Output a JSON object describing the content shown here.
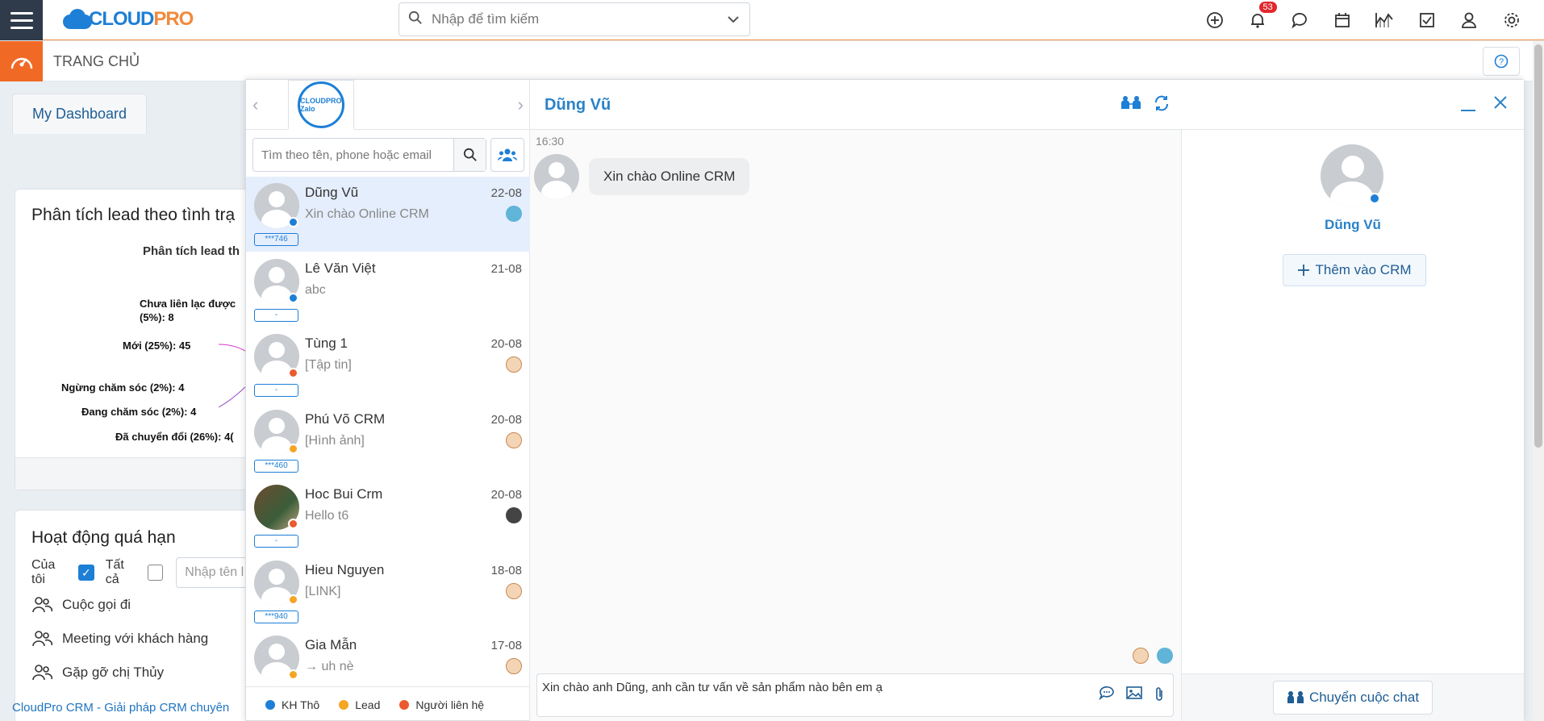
{
  "header": {
    "logo_text_a": "CLOUD",
    "logo_text_b": "PRO",
    "search_placeholder": "Nhập để tìm kiếm",
    "notification_count": "53",
    "icons": [
      "plus-circle-icon",
      "bell-icon",
      "chat-icon",
      "calendar-icon",
      "chart-icon",
      "checkbox-icon",
      "user-icon",
      "gear-icon"
    ]
  },
  "subbar": {
    "title": "TRANG CHỦ"
  },
  "dashboard": {
    "tab": "My Dashboard",
    "card1": {
      "title": "Phân tích lead theo tình trạ",
      "subtitle": "Phân tích lead th",
      "labels": [
        "Chưa liên lạc được",
        "(5%): 8",
        "Mới (25%): 45",
        "Ngừng chăm sóc (2%): 4",
        "Đang chăm sóc (2%): 4",
        "Đã chuyển đổi (26%): 4("
      ]
    },
    "card2": {
      "title": "Hoạt động quá hạn",
      "mine": "Của tôi",
      "all": "Tất cả",
      "input_placeholder": "Nhập tên l",
      "items": [
        "Cuộc gọi đi",
        "Meeting với khách hàng",
        "Gặp gỡ chị Thủy"
      ]
    },
    "footer": "CloudPro CRM - Giải pháp CRM chuyên"
  },
  "chat": {
    "search_placeholder": "Tìm theo tên, phone hoặc email",
    "account_logo": "CLOUDPRO Zalo",
    "conversations": [
      {
        "name": "Dũng Vũ",
        "date": "22-08",
        "message": "Xin chào Online CRM",
        "tag": "***746",
        "status": "kh",
        "mini": "blue",
        "active": true
      },
      {
        "name": "Lê Văn Việt",
        "date": "21-08",
        "message": "abc",
        "tag": "-",
        "status": "kh",
        "mini": "",
        "active": false
      },
      {
        "name": "Tùng 1",
        "date": "20-08",
        "message": "[Tập tin]",
        "tag": "-",
        "status": "nlh",
        "mini": "agent",
        "active": false
      },
      {
        "name": "Phú Võ CRM",
        "date": "20-08",
        "message": "[Hình ảnh]",
        "tag": "***460",
        "status": "lead",
        "mini": "agent",
        "active": false
      },
      {
        "name": "Hoc Bui Crm",
        "date": "20-08",
        "message": "Hello t6",
        "tag": "-",
        "status": "nlh",
        "mini": "dark",
        "active": false,
        "photo": true
      },
      {
        "name": "Hieu Nguyen",
        "date": "18-08",
        "message": "[LINK]",
        "tag": "***940",
        "status": "lead",
        "mini": "agent",
        "active": false
      },
      {
        "name": "Gia Mẫn",
        "date": "17-08",
        "message": "→ uh nè",
        "tag": "",
        "status": "lead",
        "mini": "agent",
        "active": false
      }
    ],
    "legend": [
      {
        "label": "KH Thô",
        "color": "#1d7fd6"
      },
      {
        "label": "Lead",
        "color": "#f5a623"
      },
      {
        "label": "Người liên hệ",
        "color": "#ea5a2c"
      }
    ],
    "active_name": "Dũng Vũ",
    "time": "16:30",
    "message": "Xin chào Online CRM",
    "composer_text": "Xin chào anh Dũng, anh cần tư vấn về sản phẩm nào bên em ạ",
    "info_name": "Dũng Vũ",
    "add_crm": "Thêm vào CRM",
    "transfer": "Chuyển cuộc chat"
  }
}
